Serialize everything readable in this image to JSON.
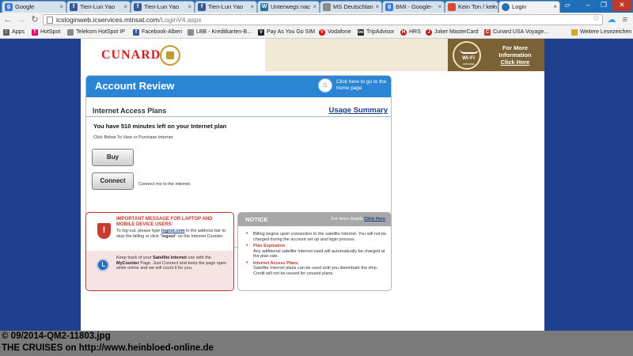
{
  "browser": {
    "tabs": [
      {
        "title": "Google",
        "icon": "google-icon",
        "color": "#3b78e7",
        "glyph": "g"
      },
      {
        "title": "Tien-Lun Yao",
        "icon": "facebook-icon",
        "color": "#3b5998",
        "glyph": "f"
      },
      {
        "title": "Tien-Lun Yao",
        "icon": "facebook-icon",
        "color": "#3b5998",
        "glyph": "f"
      },
      {
        "title": "Tien-Lun Yao",
        "icon": "facebook-icon",
        "color": "#3b5998",
        "glyph": "f"
      },
      {
        "title": "Unterwegs nac",
        "icon": "wordpress-icon",
        "color": "#21759b",
        "glyph": "W"
      },
      {
        "title": "MS Deutschlan",
        "icon": "page-icon",
        "color": "#8a8a8a",
        "glyph": ""
      },
      {
        "title": "BMI - Google-",
        "icon": "google-icon",
        "color": "#3b78e7",
        "glyph": "g"
      },
      {
        "title": "Kein Ton / kein",
        "icon": "blog-icon",
        "color": "#d94b2b",
        "glyph": ""
      },
      {
        "title": "Login",
        "icon": "globe-icon",
        "color": "#2b6cb8",
        "glyph": ""
      }
    ],
    "url_host": "icsloginweb.icservices.mtnsat.com",
    "url_path": "/LoginV4.aspx",
    "bookmarks": [
      {
        "label": "Apps",
        "icon": "apps-icon",
        "color": "#5f6368",
        "glyph": "⁝"
      },
      {
        "label": "HotSpot",
        "icon": "telekom-icon",
        "color": "#e20074",
        "glyph": "T"
      },
      {
        "label": "Telekom HotSpot IP",
        "icon": "page-icon",
        "color": "#8a8a8a",
        "glyph": ""
      },
      {
        "label": "Facebook-Alben",
        "icon": "facebook-icon",
        "color": "#3b5998",
        "glyph": "f"
      },
      {
        "label": "LBB - Kreditkarten-B...",
        "icon": "page-icon",
        "color": "#8a8a8a",
        "glyph": ""
      },
      {
        "label": "Pay As You Go SIM",
        "icon": "vodafone-icon",
        "color": "#222222",
        "glyph": "V"
      },
      {
        "label": "Vodafone",
        "icon": "vodafone-icon",
        "color": "#e60000",
        "glyph": "V"
      },
      {
        "label": "TripAdvisor",
        "icon": "tripadvisor-icon",
        "color": "#222222",
        "glyph": "oo"
      },
      {
        "label": "HRS",
        "icon": "hrs-icon",
        "color": "#cc1e1e",
        "glyph": "H"
      },
      {
        "label": "Joker MasterCard",
        "icon": "joker-icon",
        "color": "#b01e1e",
        "glyph": "J"
      },
      {
        "label": "Cunard USA Voyage...",
        "icon": "cunard-icon",
        "color": "#c0392b",
        "glyph": "C"
      },
      {
        "label": "Weitere Lesezeichen",
        "icon": "folder-icon",
        "color": "#d4a82d",
        "glyph": ""
      }
    ]
  },
  "brand": {
    "name": "CUNARD",
    "wifi_label": "Wi-Fi",
    "wifi_sub": "onboard",
    "wifi_line1": "For More",
    "wifi_line2": "Information",
    "wifi_line3": "Click Here"
  },
  "account": {
    "title": "Account Review",
    "home_link": "Click here to go to the home page",
    "section_label": "Internet Access Plans",
    "usage_link": "Usage Summary",
    "minutes_text": "You have 510 minutes left on your Internet plan",
    "click_below": "Click Below To View or Purchase Internet",
    "buy_label": "Buy",
    "connect_label": "Connect",
    "connect_note": "Connect me to the internet."
  },
  "important": {
    "title": "IMPORTANT MESSAGE FOR LAPTOP AND MOBILE DEVICE USERS:",
    "logout_pre": "To log-out, please type ",
    "logout_link": "logout.com",
    "logout_mid": " in the address bar to stop the billing or click \"",
    "logout_word": "logout",
    "logout_post": "\" on the Internet Counter.",
    "track_pre": "Keep track of your ",
    "track_bold1": "Satellite Internet",
    "track_mid": " use with the ",
    "track_bold2": "MyCounter",
    "track_post": " Page. Just Connect and keep the page open while online and we will count it for you."
  },
  "notice": {
    "title": "NOTICE",
    "more_pre": "For more details ",
    "more_link": "Click Here",
    "item1_head": "",
    "item1_text": "Billing begins upon connection to the satellite Internet. You will not be charged during the account set up and login process.",
    "item2_head": "Plan Expiration",
    "item2_text": "Any additional satellite Internet used will automatically be charged at the plan rate.",
    "item3_head": "Internet Access Plans",
    "item3_text": "Satellite Internet plans can be used until you disembark the ship. Credit will not be issued for unused plans."
  },
  "caption": {
    "line1": "© 09/2014-QM2-11803.jpg",
    "line2": " THE CRUISES on http://www.heinbloed-online.de"
  }
}
